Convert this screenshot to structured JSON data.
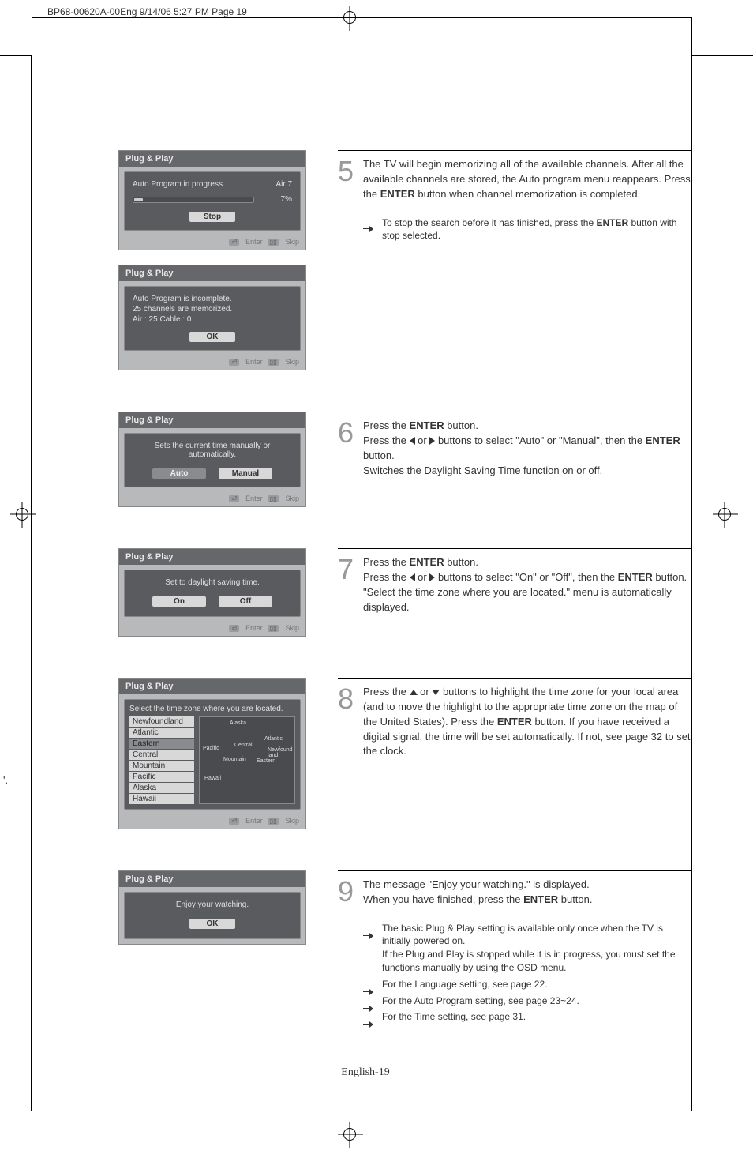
{
  "print_header": "BP68-00620A-00Eng  9/14/06  5:27 PM  Page 19",
  "osd": {
    "title": "Plug & Play",
    "footer_enter": "Enter",
    "footer_skip": "Skip",
    "btn_stop": "Stop",
    "btn_ok": "OK",
    "btn_auto": "Auto",
    "btn_manual": "Manual",
    "btn_on": "On",
    "btn_off": "Off",
    "s5a_msg": "Auto Program in progress.",
    "s5a_ch": "Air 7",
    "s5a_pct": "7%",
    "s5b_l1": "Auto Program is incomplete.",
    "s5b_l2": "25 channels are memorized.",
    "s5b_l3": "Air : 25    Cable : 0",
    "s6_msg": "Sets the current time manually or automatically.",
    "s7_msg": "Set to daylight saving time.",
    "s8_msg": "Select the time zone where you are located.",
    "s9_msg": "Enjoy your watching.",
    "tz_items": [
      "Newfoundland",
      "Atlantic",
      "Eastern",
      "Central",
      "Mountain",
      "Pacific",
      "Alaska",
      "Hawaii"
    ],
    "map_labels": [
      "Alaska",
      "Pacific",
      "Central",
      "Atlantic",
      "Mountain",
      "Eastern",
      "Newfound land",
      "Hawaii"
    ]
  },
  "steps": {
    "s5_num": "5",
    "s5_1": "The TV will begin memorizing all of the available channels. After all the available channels are stored, the Auto program menu reappears. Press the ",
    "s5_enter": "ENTER",
    "s5_2": " button when channel memorization is completed.",
    "s5_note_1": "To stop the search before it has finished, press the ",
    "s5_note_2": " button with stop selected.",
    "s6_num": "6",
    "s6_1": "Press the ",
    "s6_2": " button.",
    "s6_3": " buttons to select \"Auto\" or \"Manual\", then the ",
    "s6_or": " or ",
    "s6_4": "Switches the Daylight Saving Time function on or off.",
    "s7_num": "7",
    "s7_3": " buttons to select \"On\" or \"Off\", then the ",
    "s7_4": " button. \"Select the time zone where you are located.\" menu is automatically displayed.",
    "s8_num": "8",
    "s8_1": " buttons to highlight the time zone for your local area (and to move the highlight to the appropriate time zone on the map of the United States). Press the ",
    "s8_2": " button. If you have received a digital signal, the time will be set automatically. If not, see page 32 to set the clock.",
    "s9_num": "9",
    "s9_1": "The message \"Enjoy your watching.\" is displayed.",
    "s9_2": "When you have finished, press the ",
    "notes": {
      "n1a": "The basic Plug & Play setting is available only once when the TV is initially powered on.",
      "n1b": "If the Plug and Play is stopped while it is in progress, you must set the functions manually by using the OSD menu.",
      "n2": "For the Language setting, see page 22.",
      "n3": "For the Auto Program setting, see page 23~24.",
      "n4": "For the Time setting, see page 31."
    }
  },
  "page_footer": "English-19"
}
